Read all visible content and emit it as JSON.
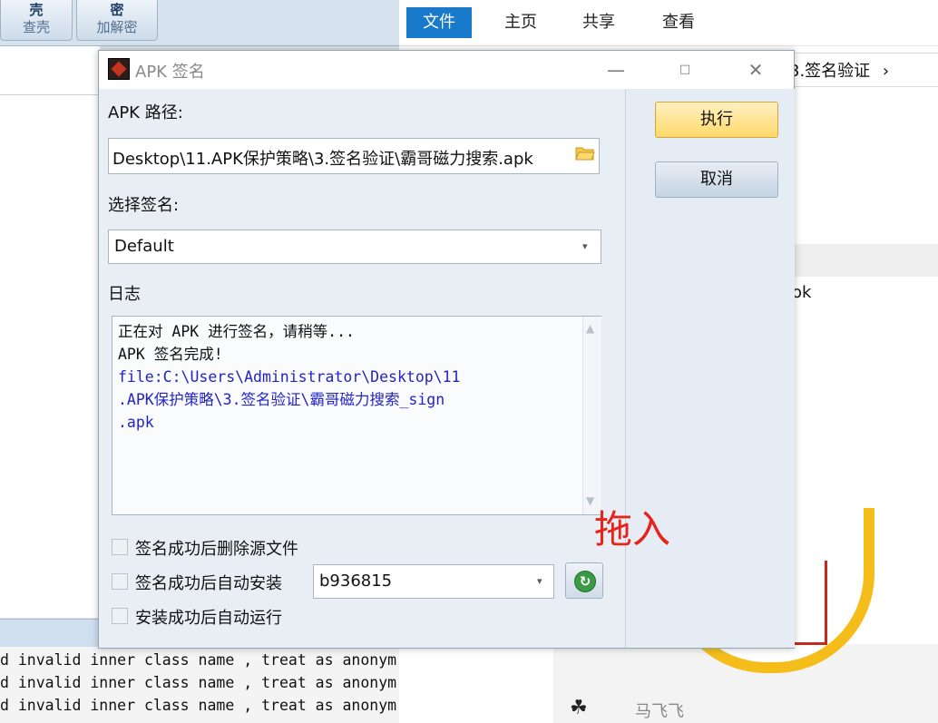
{
  "background_tool": {
    "toolbar_buttons": [
      {
        "glyph": "壳",
        "label": "查壳"
      },
      {
        "glyph": "密",
        "label": "加解密"
      }
    ],
    "console_lines": [
      "d invalid inner class name , treat as anonym",
      "d invalid inner class name , treat as anonym",
      "d invalid inner class name , treat as anonym"
    ]
  },
  "explorer": {
    "ribbon_tabs": [
      "文件",
      "主页",
      "共享",
      "查看"
    ],
    "breadcrumb_tail": "3.签名验证",
    "breadcrumb_chevron": "›",
    "file_partial": "ok",
    "user_name": "马飞飞",
    "accent_color": "#1979ca"
  },
  "dialog": {
    "title": "APK 签名",
    "controls": {
      "minimize": "—",
      "maximize": "□",
      "close": "✕"
    },
    "apk_path_label": "APK 路径:",
    "apk_path_value": "Desktop\\11.APK保护策略\\3.签名验证\\霸哥磁力搜索.apk",
    "select_sign_label": "选择签名:",
    "select_sign_value": "Default",
    "log_label": "日志",
    "log_lines": [
      {
        "text": "正在对 APK 进行签名，请稍等...",
        "color": "#111111"
      },
      {
        "text": "APK 签名完成!",
        "color": "#111111"
      },
      {
        "text": "file:C:\\Users\\Administrator\\Desktop\\11",
        "color": "#2323c8"
      },
      {
        "text": ".APK保护策略\\3.签名验证\\霸哥磁力搜索_sign",
        "color": "#2323c8"
      },
      {
        "text": ".apk",
        "color": "#2323c8"
      }
    ],
    "options": {
      "delete_source": {
        "label": "签名成功后删除源文件",
        "checked": false
      },
      "auto_install": {
        "label": "签名成功后自动安装",
        "checked": false
      },
      "auto_run": {
        "label": "安装成功后自动运行",
        "checked": false
      }
    },
    "device_value": "b936815",
    "execute_label": "执行",
    "cancel_label": "取消"
  },
  "annotation_text": "拖入"
}
